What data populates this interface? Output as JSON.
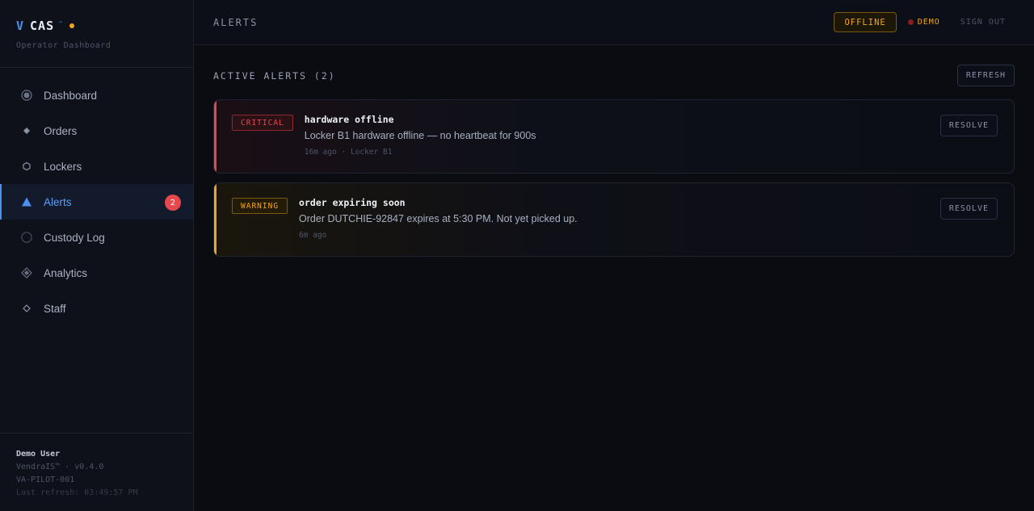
{
  "brand": {
    "v": "V",
    "name": "CAS",
    "tm": "™",
    "subtitle": "Operator Dashboard",
    "status_dot_color": "#f2a51a"
  },
  "nav": [
    {
      "label": "Dashboard",
      "icon": "radio-dot-icon",
      "active": false
    },
    {
      "label": "Orders",
      "icon": "diamond-small-icon",
      "active": false
    },
    {
      "label": "Lockers",
      "icon": "hexagon-outline-icon",
      "active": false
    },
    {
      "label": "Alerts",
      "icon": "triangle-icon",
      "active": true,
      "badge": "2"
    },
    {
      "label": "Custody Log",
      "icon": "circle-outline-icon",
      "active": false
    },
    {
      "label": "Analytics",
      "icon": "diamond-target-icon",
      "active": false
    },
    {
      "label": "Staff",
      "icon": "diamond-outline-icon",
      "active": false
    }
  ],
  "sidebar_footer": {
    "user": "Demo User",
    "version": "VendraIS™ · v0.4.0",
    "site": "VA-PILOT-001",
    "refresh": "Last refresh: 03:49:57 PM"
  },
  "topbar": {
    "title": "ALERTS",
    "offline_label": "OFFLINE",
    "demo_label": "DEMO",
    "signout_label": "SIGN OUT"
  },
  "main": {
    "section_title": "ACTIVE ALERTS (2)",
    "refresh_label": "REFRESH",
    "alerts": [
      {
        "severity": "CRITICAL",
        "title": "hardware offline",
        "message": "Locker B1 hardware offline — no heartbeat for 900s",
        "meta": "16m ago · Locker B1",
        "action": "RESOLVE"
      },
      {
        "severity": "WARNING",
        "title": "order expiring soon",
        "message": "Order DUTCHIE-92847 expires at 5:30 PM. Not yet picked up.",
        "meta": "6m ago",
        "action": "RESOLVE"
      }
    ]
  },
  "colors": {
    "accent": "#4a90f0",
    "critical": "#e5484d",
    "warning": "#f2a51a",
    "background": "#0a0c12"
  }
}
